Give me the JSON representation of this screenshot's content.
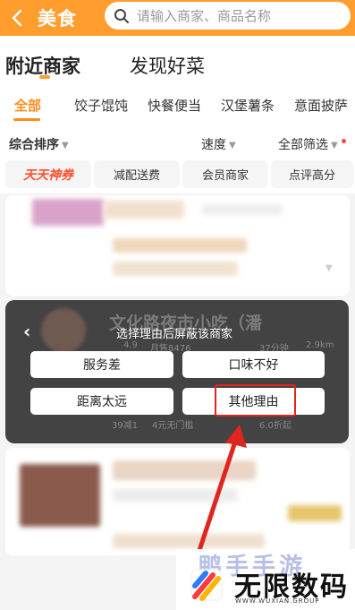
{
  "header": {
    "title": "美食",
    "search_placeholder": "请输入商家、商品名称"
  },
  "top_tabs": [
    {
      "label": "附近商家"
    },
    {
      "label": "发现好菜"
    }
  ],
  "categories": [
    {
      "label": "全部"
    },
    {
      "label": "饺子馄饨"
    },
    {
      "label": "快餐便当"
    },
    {
      "label": "汉堡薯条"
    },
    {
      "label": "意面披萨"
    }
  ],
  "sort": {
    "default": "综合排序",
    "speed": "速度",
    "filter": "全部筛选"
  },
  "chips": [
    {
      "label": "天天神券"
    },
    {
      "label": "减配送费"
    },
    {
      "label": "会员商家"
    },
    {
      "label": "点评高分"
    }
  ],
  "dialog": {
    "title": "选择理由后屏蔽该商家",
    "reasons": [
      {
        "label": "服务差"
      },
      {
        "label": "口味不好"
      },
      {
        "label": "距离太远"
      },
      {
        "label": "其他理由"
      }
    ],
    "blurred_store_name": "文化路夜市小吃（潘",
    "blurred_fragments": [
      "4.9",
      "月售8476",
      "37分钟",
      "2.9km",
      "39减1",
      "4元无门槛",
      "6.0折起"
    ]
  },
  "watermark": {
    "main": "无限数码",
    "sub": "WWW.WUXIAN.GROUP",
    "faint": "鸭手手游"
  },
  "colors": {
    "brand_orange": "#ff9d2e",
    "accent_orange": "#ff8c1a",
    "highlight_red": "#e0241f"
  }
}
